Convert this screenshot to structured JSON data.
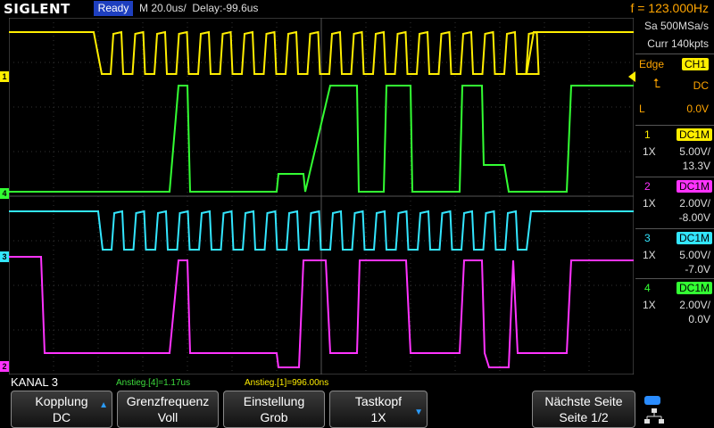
{
  "header": {
    "brand": "SIGLENT",
    "status": "Ready",
    "timebase": "M 20.0us/",
    "delay": "Delay:-99.6us",
    "frequency": "f = 123.000Hz"
  },
  "acquisition": {
    "sample_rate": "Sa 500MSa/s",
    "memory": "Curr 140kpts"
  },
  "trigger": {
    "type": "Edge",
    "source": "CH1",
    "coupling": "DC",
    "level_label": "L",
    "level": "0.0V"
  },
  "channels": [
    {
      "num": "1",
      "coupling": "DC1M",
      "probe": "1X",
      "scale": "5.00V/",
      "offset": "13.3V",
      "color": "#ffee00"
    },
    {
      "num": "2",
      "coupling": "DC1M",
      "probe": "1X",
      "scale": "2.00V/",
      "offset": "-8.00V",
      "color": "#ff33ff"
    },
    {
      "num": "3",
      "coupling": "DC1M",
      "probe": "1X",
      "scale": "5.00V/",
      "offset": "-7.0V",
      "color": "#33e6ff"
    },
    {
      "num": "4",
      "coupling": "DC1M",
      "probe": "1X",
      "scale": "2.00V/",
      "offset": "0.0V",
      "color": "#33ff33"
    }
  ],
  "info": {
    "channel_title": "KANAL 3",
    "meas1": "Anstieg.[4]=1.17us",
    "meas2": "Anstieg.[1]=996.00ns"
  },
  "softmenu": [
    {
      "line1": "Kopplung",
      "line2": "DC",
      "arrow": "up"
    },
    {
      "line1": "Grenzfrequenz",
      "line2": "Voll",
      "arrow": ""
    },
    {
      "line1": "Einstellung",
      "line2": "Grob",
      "arrow": ""
    },
    {
      "line1": "Tastkopf",
      "line2": "1X",
      "arrow": "down"
    },
    {
      "line1": "Nächste Seite",
      "line2": "Seite 1/2",
      "arrow": ""
    }
  ],
  "markers": {
    "ch1": "1",
    "ch4": "4",
    "ch3": "3",
    "ch2": "2"
  }
}
